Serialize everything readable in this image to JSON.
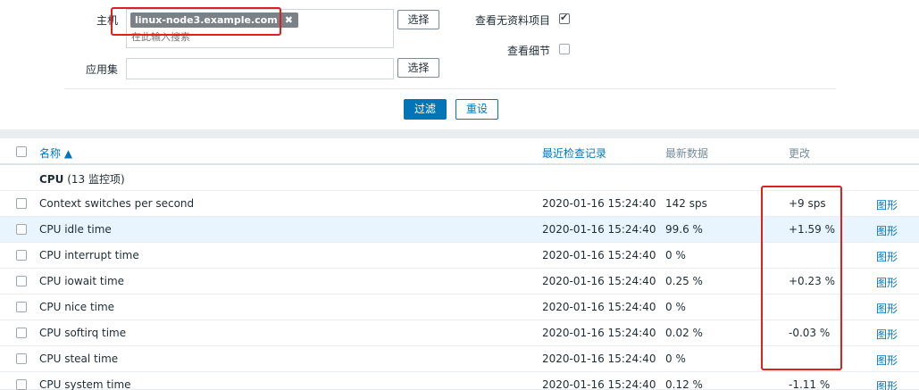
{
  "filter": {
    "host_label": "主机",
    "host_chip": "linux-node3.example.com",
    "host_placeholder": "在此输入搜索",
    "select_label": "选择",
    "app_label": "应用集",
    "app_value": "",
    "show_nodata_label": "查看无资料项目",
    "show_nodata_checked": true,
    "show_details_label": "查看细节",
    "show_details_checked": false,
    "filter_button": "过滤",
    "reset_button": "重设"
  },
  "table": {
    "headers": {
      "name": "名称 ▲",
      "last_check": "最近检查记录",
      "last_value": "最新数据",
      "change": "更改"
    },
    "group": {
      "name": "CPU",
      "count": "(13 监控项)"
    },
    "graph_label": "图形",
    "rows": [
      {
        "name": "Context switches per second",
        "last_check": "2020-01-16 15:24:40",
        "last_value": "142 sps",
        "change": "+9 sps"
      },
      {
        "name": "CPU idle time",
        "last_check": "2020-01-16 15:24:40",
        "last_value": "99.6 %",
        "change": "+1.59 %"
      },
      {
        "name": "CPU interrupt time",
        "last_check": "2020-01-16 15:24:40",
        "last_value": "0 %",
        "change": ""
      },
      {
        "name": "CPU iowait time",
        "last_check": "2020-01-16 15:24:40",
        "last_value": "0.25 %",
        "change": "+0.23 %"
      },
      {
        "name": "CPU nice time",
        "last_check": "2020-01-16 15:24:40",
        "last_value": "0 %",
        "change": ""
      },
      {
        "name": "CPU softirq time",
        "last_check": "2020-01-16 15:24:40",
        "last_value": "0.02 %",
        "change": "-0.03 %"
      },
      {
        "name": "CPU steal time",
        "last_check": "2020-01-16 15:24:40",
        "last_value": "0 %",
        "change": ""
      },
      {
        "name": "CPU system time",
        "last_check": "2020-01-16 15:24:40",
        "last_value": "0.12 %",
        "change": "-1.11 %"
      }
    ]
  },
  "colors": {
    "link": "#0275b8",
    "highlight": "#e0201e",
    "hover_row": "#e8f5ff"
  }
}
